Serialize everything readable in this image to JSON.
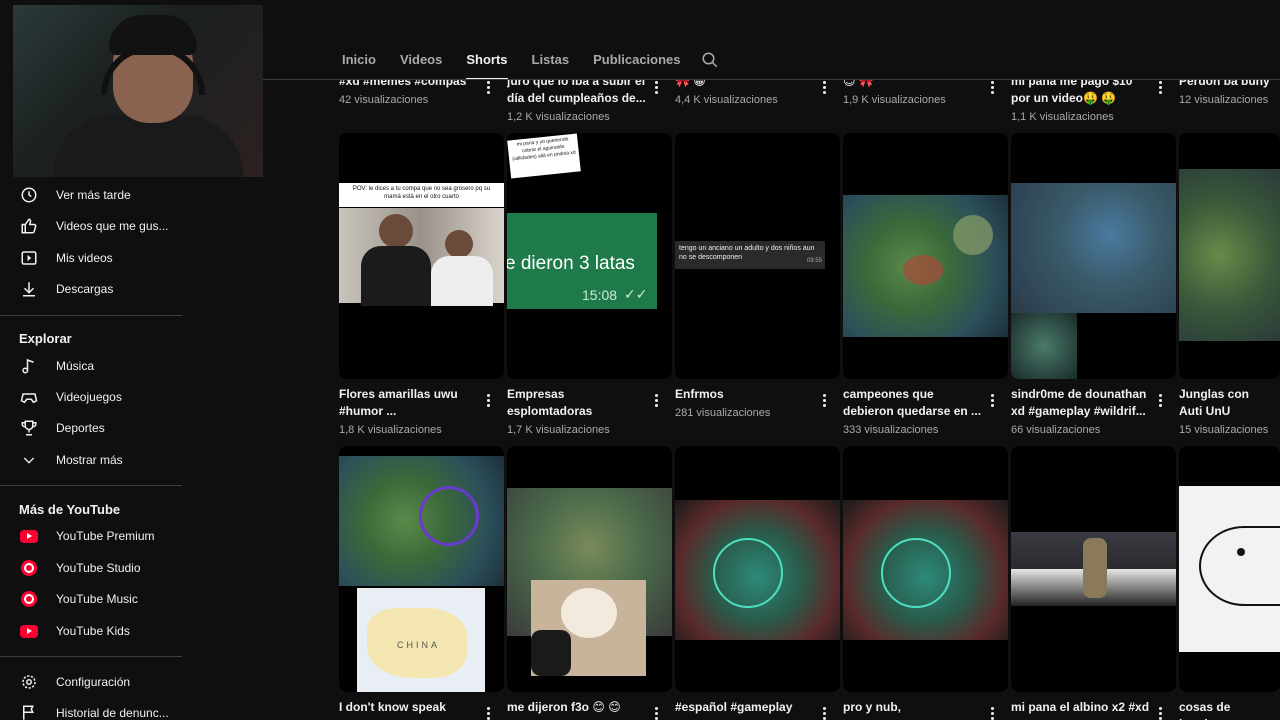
{
  "search": {
    "placeholder": "Buscar"
  },
  "tabs": [
    {
      "label": "Inicio"
    },
    {
      "label": "Videos"
    },
    {
      "label": "Shorts",
      "active": true
    },
    {
      "label": "Listas"
    },
    {
      "label": "Publicaciones"
    }
  ],
  "sidebar": {
    "library": [
      {
        "label": "Ver más tarde",
        "icon": "clock-icon"
      },
      {
        "label": "Videos que me gus...",
        "icon": "thumbs-up-icon"
      },
      {
        "label": "Mis videos",
        "icon": "play-square-icon"
      },
      {
        "label": "Descargas",
        "icon": "download-icon"
      }
    ],
    "explore_heading": "Explorar",
    "explore": [
      {
        "label": "Música",
        "icon": "music-note-icon"
      },
      {
        "label": "Videojuegos",
        "icon": "gamepad-icon"
      },
      {
        "label": "Deportes",
        "icon": "trophy-icon"
      },
      {
        "label": "Mostrar más",
        "icon": "chevron-down-icon"
      }
    ],
    "more_heading": "Más de YouTube",
    "more": [
      {
        "label": "YouTube Premium",
        "icon": "youtube-premium-icon"
      },
      {
        "label": "YouTube Studio",
        "icon": "youtube-studio-icon"
      },
      {
        "label": "YouTube Music",
        "icon": "youtube-music-icon"
      },
      {
        "label": "YouTube Kids",
        "icon": "youtube-kids-icon"
      }
    ],
    "settings": [
      {
        "label": "Configuración",
        "icon": "gear-icon"
      },
      {
        "label": "Historial de denunc...",
        "icon": "flag-icon"
      }
    ]
  },
  "row0": [
    {
      "title": "#xd #memes #compas",
      "views": "42 visualizaciones"
    },
    {
      "title": "juro que lo iba a subir el día del cumpleaños de...",
      "views": "1,2 K visualizaciones"
    },
    {
      "title": "🎀 😀",
      "views": "4,4 K visualizaciones"
    },
    {
      "title": "😊 🎀",
      "views": "1,9 K visualizaciones"
    },
    {
      "title": "mi pana me pago $10 por un video🤑 🤑",
      "views": "1,1 K visualizaciones"
    },
    {
      "title": "Perdon ba buny",
      "views": "12 visualizaciones"
    }
  ],
  "row1": [
    {
      "title": "Flores amarillas uwu #humor ...",
      "views": "1,8 K visualizaciones",
      "thumb_caption": "POV: le dices a tu compa que no sea grosero pq su mamá está en el otro cuarto"
    },
    {
      "title": "Empresas esplomtadoras",
      "views": "1,7 K visualizaciones",
      "thumb_caption": "mi pana y yo queriendo cobrar el aguinaldo (utilidades) allá en pndnia xd",
      "chat_text": "e dieron 3 latas",
      "chat_time": "15:08"
    },
    {
      "title": "Enfrmos",
      "views": "281 visualizaciones",
      "thumb_caption": "tengo un anciano un adulto y dos niños aun no se descomponen",
      "caption_time": "09:55"
    },
    {
      "title": "campeones que debieron quedarse en ...",
      "views": "333 visualizaciones"
    },
    {
      "title": "sindr0me de dounathan xd #gameplay #wildrif...",
      "views": "66 visualizaciones"
    },
    {
      "title": "Junglas con Auti UnU",
      "views": "15 visualizaciones"
    }
  ],
  "row2": [
    {
      "title": "I don't know speak",
      "map_label": "CHINA"
    },
    {
      "title": "me dijeron f3o 😊 😊"
    },
    {
      "title": "#español #gameplay"
    },
    {
      "title": "pro y nub,"
    },
    {
      "title": "mi pana el albino x2 #xd"
    },
    {
      "title": "cosas de hombre"
    }
  ],
  "colors": {
    "accent": "#ff0033",
    "background": "#0f0f0f",
    "chat_green": "#1f7a4a"
  }
}
